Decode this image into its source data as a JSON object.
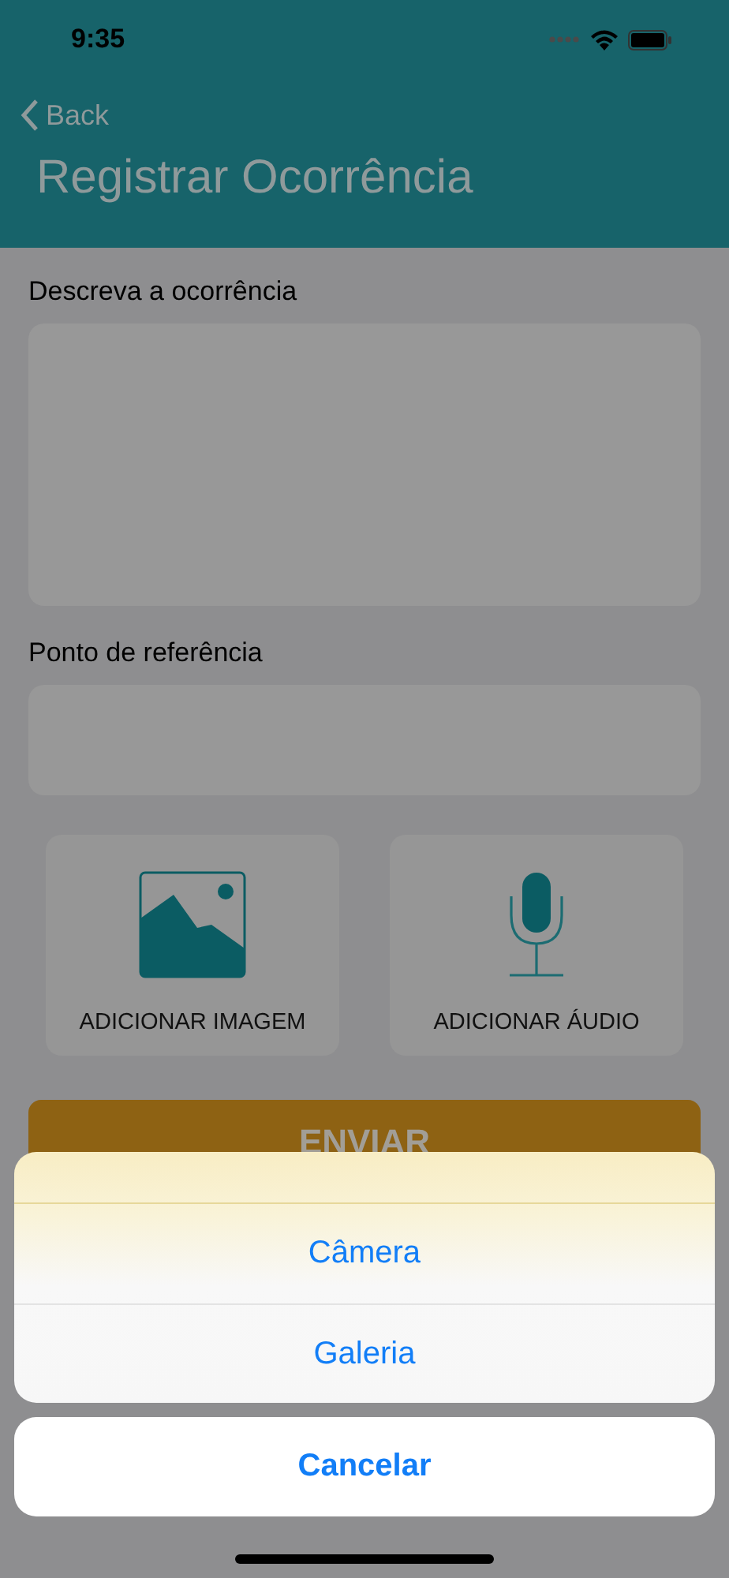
{
  "status_bar": {
    "time": "9:35"
  },
  "nav": {
    "back": "Back",
    "title": "Registrar Ocorrência"
  },
  "form": {
    "description_label": "Descreva a ocorrência",
    "reference_label": "Ponto de referência",
    "attachments": [
      {
        "kind": "image",
        "label": "ADICIONAR IMAGEM"
      },
      {
        "kind": "audio",
        "label": "ADICIONAR ÁUDIO"
      }
    ],
    "submit": "ENVIAR"
  },
  "action_sheet": {
    "options": [
      "Câmera",
      "Galeria"
    ],
    "cancel": "Cancelar"
  }
}
